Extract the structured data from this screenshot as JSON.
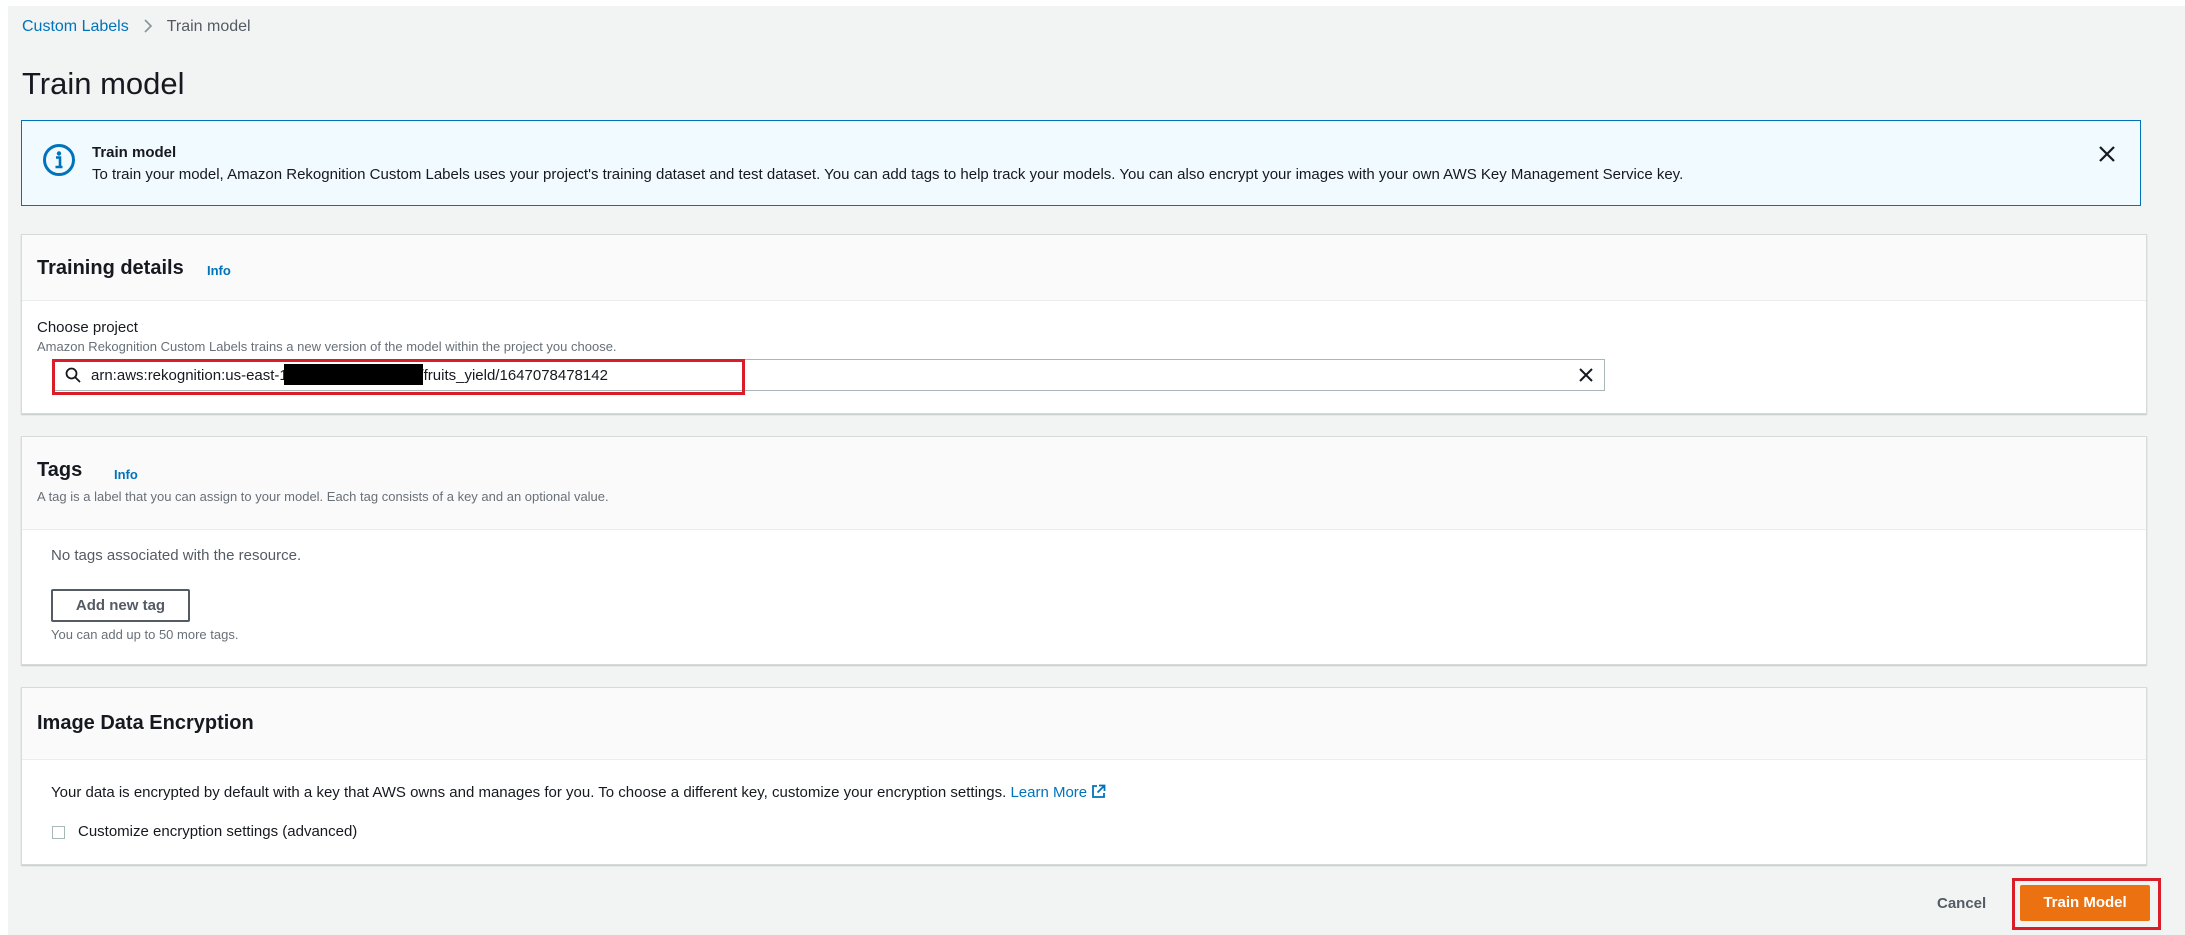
{
  "breadcrumb": {
    "parent": "Custom Labels",
    "current": "Train model"
  },
  "page_title": "Train model",
  "alert": {
    "title": "Train model",
    "text": "To train your model, Amazon Rekognition Custom Labels uses your project's training dataset and test dataset. You can add tags to help track your models. You can also encrypt your images with your own AWS Key Management Service key."
  },
  "training_details": {
    "heading": "Training details",
    "info": "Info",
    "project_label": "Choose project",
    "project_desc": "Amazon Rekognition Custom Labels trains a new version of the model within the project you choose.",
    "project_value_prefix": "arn:aws:rekognition:us-east-1",
    "project_value_suffix": "roject/fruits_yield/1647078478142"
  },
  "tags": {
    "heading": "Tags",
    "info": "Info",
    "desc": "A tag is a label that you can assign to your model. Each tag consists of a key and an optional value.",
    "empty": "No tags associated with the resource.",
    "add_button": "Add new tag",
    "limit": "You can add up to 50 more tags."
  },
  "encryption": {
    "heading": "Image Data Encryption",
    "text": "Your data is encrypted by default with a key that AWS owns and manages for you. To choose a different key, customize your encryption settings.",
    "learn_more": "Learn More",
    "checkbox_label": "Customize encryption settings (advanced)",
    "checkbox_checked": false
  },
  "footer": {
    "cancel": "Cancel",
    "submit": "Train Model"
  },
  "colors": {
    "link": "#0073bb",
    "primary": "#ec7211",
    "highlight": "#d91e2a"
  }
}
